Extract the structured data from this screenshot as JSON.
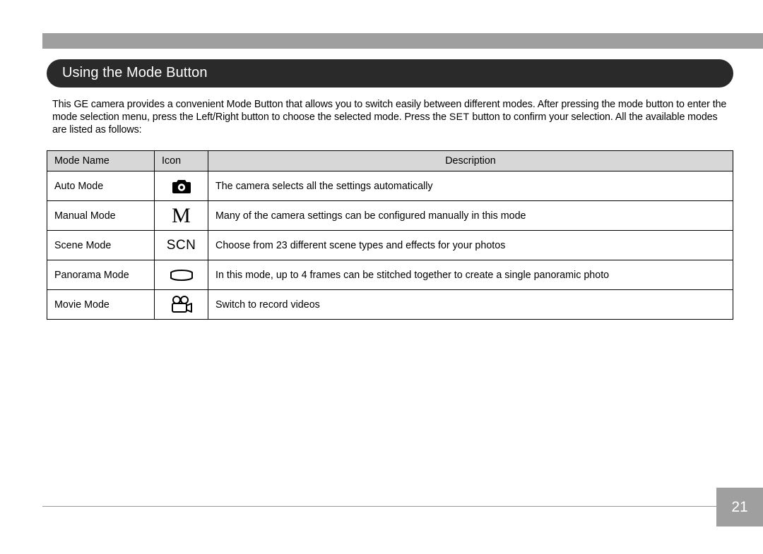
{
  "section_title": "Using the Mode Button",
  "intro_parts": {
    "before_set": "This GE camera provides a convenient Mode Button that allows you to switch easily between different modes. After pressing the mode button to enter the mode selection menu, press the Left/Right button to choose the selected mode. Press the ",
    "set_word": "SET",
    "after_set": " button to confirm your selection. All the available modes are listed as follows:"
  },
  "table": {
    "headers": {
      "name": "Mode Name",
      "icon": "Icon",
      "desc": "Description"
    },
    "rows": [
      {
        "name": "Auto Mode",
        "icon_key": "camera",
        "desc": "The camera selects all the settings automatically"
      },
      {
        "name": "Manual Mode",
        "icon_key": "letter-m",
        "desc": "Many of the camera settings can be configured manually in this mode"
      },
      {
        "name": "Scene Mode",
        "icon_key": "scn",
        "desc": "Choose from 23 different scene types and effects for your photos"
      },
      {
        "name": "Panorama Mode",
        "icon_key": "panorama",
        "desc": "In this mode, up to 4 frames can be stitched together to create a single panoramic photo"
      },
      {
        "name": "Movie Mode",
        "icon_key": "movie",
        "desc": "Switch to record videos"
      }
    ]
  },
  "icon_text": {
    "letter-m": "M",
    "scn": "SCN"
  },
  "page_number": "21"
}
